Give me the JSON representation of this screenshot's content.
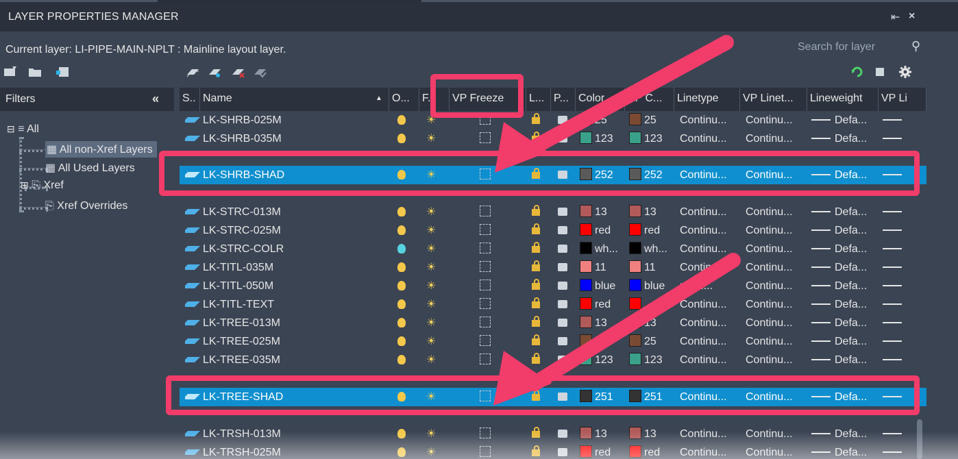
{
  "window": {
    "title": "LAYER PROPERTIES MANAGER",
    "pin_glyph": "⇤",
    "close_glyph": "×"
  },
  "current_layer_text": "Current layer: LI-PIPE-MAIN-NPLT : Mainline layout layer.",
  "search": {
    "placeholder": "Search for layer"
  },
  "filters": {
    "header": "Filters",
    "collapse_glyph": "«",
    "tree": [
      {
        "label": "All"
      },
      {
        "label": "All non-Xref Layers",
        "selected": true
      },
      {
        "label": "All Used Layers"
      },
      {
        "label": "Xref"
      },
      {
        "label": "Xref Overrides"
      }
    ]
  },
  "columns": [
    "S..",
    "Name",
    "O...",
    "F...",
    "VP Freeze",
    "L...",
    "P...",
    "Color",
    "VP C...",
    "Linetype",
    "VP Linet...",
    "Lineweight",
    "VP Li"
  ],
  "rows": [
    {
      "name": "LK-SHRB-025M",
      "color": "25",
      "vpcolor": "25",
      "swatch": "#7b4a32",
      "linetype": "Continu...",
      "vplinetype": "Continu...",
      "lineweight": "Defa...",
      "partial": true
    },
    {
      "name": "LK-SHRB-035M",
      "color": "123",
      "vpcolor": "123",
      "swatch": "#3aa08a",
      "linetype": "Continu...",
      "vplinetype": "Continu...",
      "lineweight": "Defa..."
    },
    {
      "name": "LK-SHRB-SHAD",
      "color": "252",
      "vpcolor": "252",
      "swatch": "#5a5a5a",
      "linetype": "Continu...",
      "vplinetype": "Continu...",
      "lineweight": "Defa...",
      "selected": true
    },
    {
      "name": "LK-STRC-013M",
      "color": "13",
      "vpcolor": "13",
      "swatch": "#b05a5a",
      "linetype": "Continu...",
      "vplinetype": "Continu...",
      "lineweight": "Defa..."
    },
    {
      "name": "LK-STRC-025M",
      "color": "red",
      "vpcolor": "red",
      "swatch": "#ff0000",
      "linetype": "Continu...",
      "vplinetype": "Continu...",
      "lineweight": "Defa..."
    },
    {
      "name": "LK-STRC-COLR",
      "color": "wh...",
      "vpcolor": "wh...",
      "swatch": "#000000",
      "linetype": "Continu...",
      "vplinetype": "Continu...",
      "lineweight": "Defa...",
      "cyan": true
    },
    {
      "name": "LK-TITL-035M",
      "color": "11",
      "vpcolor": "11",
      "swatch": "#f08080",
      "linetype": "Contin...",
      "vplinetype": "Continu...",
      "lineweight": "Defa..."
    },
    {
      "name": "LK-TITL-050M",
      "color": "blue",
      "vpcolor": "blue",
      "swatch": "#0000ff",
      "linetype": "ntinu...",
      "vplinetype": "Continu...",
      "lineweight": "Defa..."
    },
    {
      "name": "LK-TITL-TEXT",
      "color": "red",
      "vpcolor": "",
      "swatch": "#ff0000",
      "linetype": "Continu...",
      "vplinetype": "Continu...",
      "lineweight": "Defa..."
    },
    {
      "name": "LK-TREE-013M",
      "color": "13",
      "vpcolor": "13",
      "swatch": "#b05a5a",
      "linetype": "Continu...",
      "vplinetype": "Continu...",
      "lineweight": "Defa..."
    },
    {
      "name": "LK-TREE-025M",
      "color": "",
      "vpcolor": "25",
      "swatch": "#7b4a32",
      "linetype": "Continu...",
      "vplinetype": "Continu...",
      "lineweight": "Defa..."
    },
    {
      "name": "LK-TREE-035M",
      "color": "123",
      "vpcolor": "123",
      "swatch": "#3aa08a",
      "linetype": "Continu...",
      "vplinetype": "Continu...",
      "lineweight": "Defa..."
    },
    {
      "name": "LK-TREE-SHAD",
      "color": "251",
      "vpcolor": "251",
      "swatch": "#333333",
      "linetype": "Continu...",
      "vplinetype": "Continu...",
      "lineweight": "Defa...",
      "selected": true
    },
    {
      "name": "LK-TRSH-013M",
      "color": "13",
      "vpcolor": "13",
      "swatch": "#b05a5a",
      "linetype": "Continu...",
      "vplinetype": "Continu...",
      "lineweight": "Defa..."
    },
    {
      "name": "LK-TRSH-025M",
      "color": "red",
      "vpcolor": "red",
      "swatch": "#ff0000",
      "linetype": "Continu...",
      "vplinetype": "Continu...",
      "lineweight": "Defa..."
    }
  ],
  "colors": {
    "accent": "#f23c6a",
    "selection": "#0f8fcf",
    "panel": "#3b4453",
    "header": "#2c323d"
  }
}
